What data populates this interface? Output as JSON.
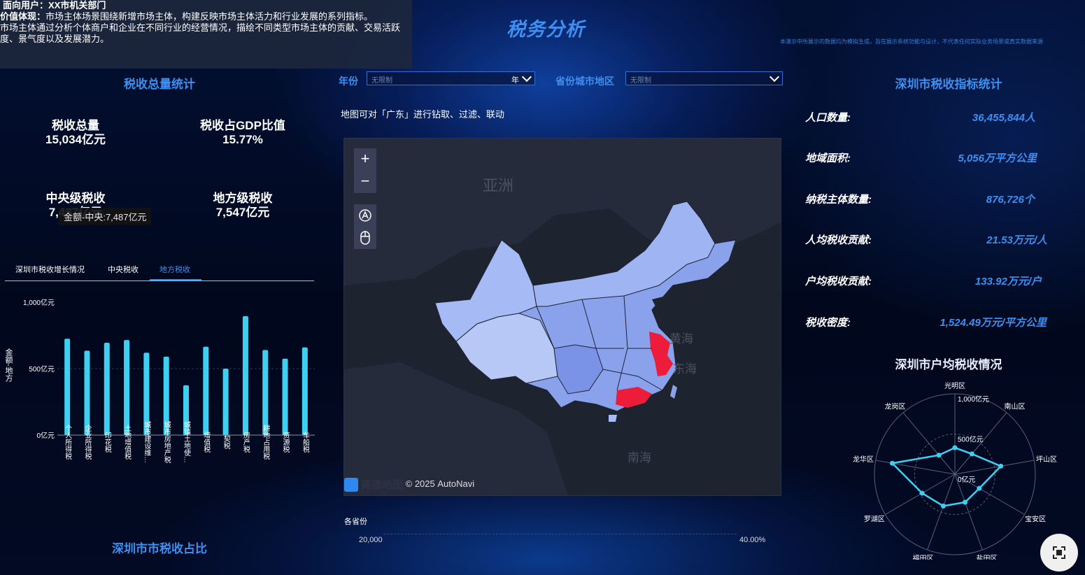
{
  "info": {
    "user_label": "面向用户：",
    "user_value": "XX市机关部门",
    "value_label": "价值体现：",
    "line1": "市场主体场景围绕新增市场主体，构建反映市场主体活力和行业发展的系列指标。",
    "line2": "市场主体通过分析个体商户和企业在不同行业的经营情况，描绘不同类型市场主体的贡献、交易活跃",
    "line3": "度、景气度以及发展潜力。"
  },
  "header": {
    "title": "税务分析",
    "disclaimer": "本演示中所展示的数据均为模拟生成，旨在展示系统功能与设计，不代表任何实际业务场景或真实数据来源"
  },
  "left": {
    "section_title": "税收总量统计",
    "stats": [
      {
        "label": "税收总量",
        "value": "15,034亿元"
      },
      {
        "label": "税收占GDP比值",
        "value": "15.77%"
      },
      {
        "label": "中央级税收",
        "value": "7,487亿元"
      },
      {
        "label": "地方级税收",
        "value": "7,547亿元"
      }
    ],
    "tooltip": "金额-中央:7,487亿元",
    "tabs": [
      "深圳市税收增长情况",
      "中央税收",
      "地方税收"
    ],
    "bottom_title": "深圳市市税收占比"
  },
  "filters": {
    "year_label": "年份",
    "year_value": "无限制",
    "year_unit": "年",
    "region_label": "省份城市地区",
    "region_value": "无限制"
  },
  "map": {
    "note": "地图可对「广东」进行钻取、过滤、联动",
    "zoom_in": "+",
    "zoom_out": "−",
    "labels": {
      "asia": "亚洲",
      "yellow_sea": "黄海",
      "east_sea": "东海",
      "south_sea": "南海"
    },
    "attribution_brand": "高德地图",
    "attribution": "© 2025 AutoNavi",
    "footer_label": "各省份",
    "footer_left": "20,000",
    "footer_right": "40.00%"
  },
  "right": {
    "section_title": "深圳市税收指标统计",
    "stats": [
      {
        "label": "人口数量:",
        "value": "36,455,844人"
      },
      {
        "label": "地域面积:",
        "value": "5,056万平方公里"
      },
      {
        "label": "纳税主体数量:",
        "value": "876,726个"
      },
      {
        "label": "人均税收贡献:",
        "value": "21.53万元/人"
      },
      {
        "label": "户均税收贡献:",
        "value": "133.92万元/户"
      },
      {
        "label": "税收密度:",
        "value": "1,524.49万元/平方公里"
      }
    ],
    "radar_title": "深圳市户均税收情况"
  },
  "chart_data": [
    {
      "type": "bar",
      "ylabel": "金额-地方",
      "ylim": [
        0,
        1000
      ],
      "yticks": [
        "1,000亿元",
        "500亿元",
        "0亿元"
      ],
      "categories": [
        "个人所得税",
        "企业所得税",
        "印花税",
        "土地增值税",
        "城市建设维…",
        "城市房地产税",
        "城镇土地使…",
        "增值税",
        "契税",
        "房产税",
        "耕地占用税",
        "资源税",
        "车船税"
      ],
      "values": [
        725,
        635,
        695,
        715,
        620,
        590,
        375,
        665,
        500,
        895,
        640,
        575,
        660
      ],
      "color": "#3ed0f2",
      "grid": true
    },
    {
      "type": "radar",
      "ylim": [
        0,
        1000
      ],
      "rticks": [
        "1,000亿元",
        "500亿元",
        "0亿元"
      ],
      "categories": [
        "光明区",
        "南山区",
        "坪山区",
        "宝安区",
        "盐田区",
        "福田区",
        "罗湖区",
        "龙华区",
        "龙岗区"
      ],
      "values": [
        330,
        330,
        580,
        350,
        370,
        420,
        470,
        790,
        310
      ],
      "color": "#3ed0f2"
    }
  ]
}
